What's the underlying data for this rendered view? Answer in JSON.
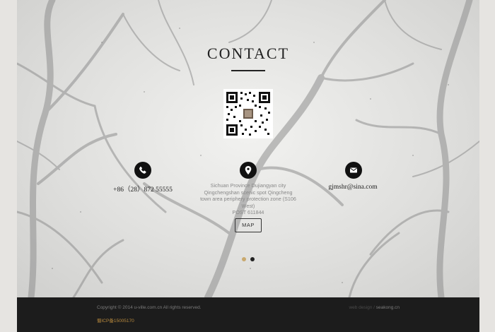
{
  "contact": {
    "title": "CONTACT",
    "phone": "+86（28）872 55555",
    "email": "gjmshr@sina.com",
    "address_lines": [
      "Sichuan Province Dujiangyan city",
      "Qingchengshan scenic spot Qingcheng",
      "town area periphery protection zone (S106",
      "West)",
      "POST 611844"
    ],
    "map_button": "MAP"
  },
  "slider": {
    "dots": 2,
    "active_index": 0,
    "active_color": "#c9a96e",
    "inactive_color": "#222222"
  },
  "footer": {
    "copyright": "Copyright © 2014 u-ville.com.cn All rights reserved.",
    "icp": "蜀ICP备15005170",
    "credit_prefix": "web design",
    "credit_sep": " / ",
    "credit_site": "seakong.cn"
  },
  "icons": {
    "phone": "phone-icon",
    "location": "location-pin-icon",
    "email": "envelope-icon",
    "qr": "qr-code"
  }
}
